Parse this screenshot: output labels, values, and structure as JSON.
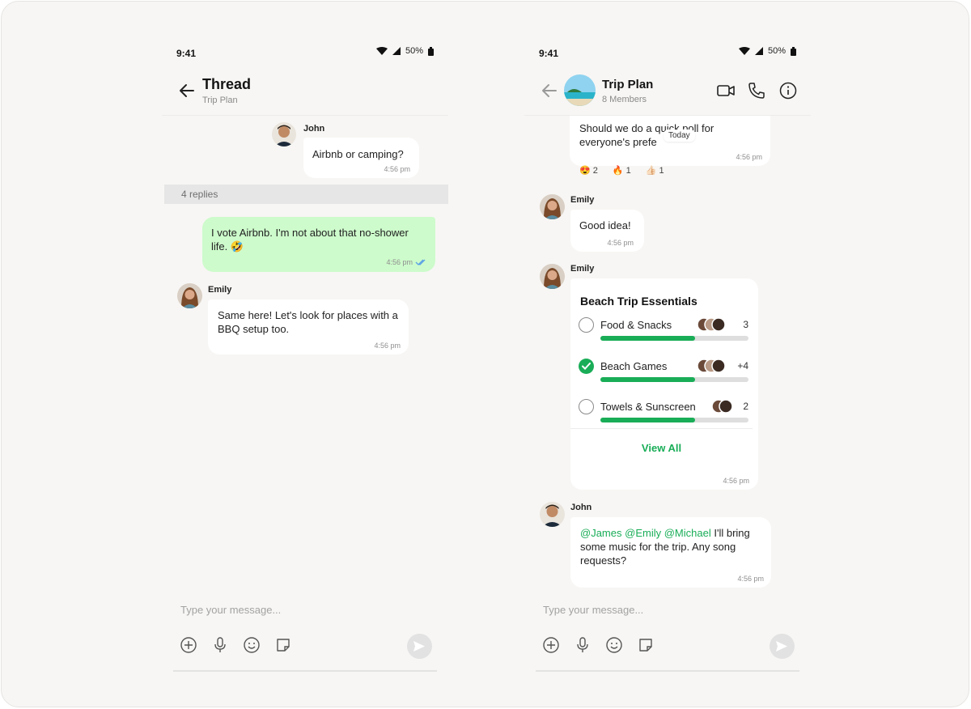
{
  "status": {
    "time": "9:41",
    "battery": "50%"
  },
  "thread": {
    "title": "Thread",
    "subtitle": "Trip Plan",
    "root": {
      "sender": "John",
      "text": "Airbnb or camping?",
      "time": "4:56 pm"
    },
    "replies_label": "4 replies",
    "mine": {
      "text": "I vote Airbnb. I'm not about that no-shower life. 🤣",
      "time": "4:56 pm"
    },
    "emily": {
      "sender": "Emily",
      "text": "Same here! Let's look for places with a BBQ setup too.",
      "time": "4:56 pm"
    },
    "composer_placeholder": "Type your message..."
  },
  "chat": {
    "title": "Trip Plan",
    "subtitle": "8 Members",
    "first": {
      "text_line1": "Should we do a quick poll for",
      "text_line2": "everyone's prefe",
      "time": "4:56 pm"
    },
    "date_pill": "Today",
    "reactions": [
      {
        "emoji": "😍",
        "count": "2"
      },
      {
        "emoji": "🔥",
        "count": "1"
      },
      {
        "emoji": "👍🏻",
        "count": "1"
      }
    ],
    "emily_msg": {
      "sender": "Emily",
      "text": "Good idea!",
      "time": "4:56 pm"
    },
    "poll": {
      "sender": "Emily",
      "title": "Beach Trip Essentials",
      "options": [
        {
          "label": "Food & Snacks",
          "count": "3",
          "checked": false,
          "fill": 0.64
        },
        {
          "label": "Beach Games",
          "count": "+4",
          "checked": true,
          "fill": 0.64
        },
        {
          "label": "Towels & Sunscreen",
          "count": "2",
          "checked": false,
          "fill": 0.64
        }
      ],
      "view_all": "View All",
      "time": "4:56 pm"
    },
    "john_msg": {
      "sender": "John",
      "mention1": "@James",
      "mention2": "@Emily",
      "mention3": "@Michael",
      "after_mentions": "I'll bring",
      "rest": "some music for the trip. Any song requests?",
      "time": "4:56 pm"
    },
    "composer_placeholder": "Type your message..."
  },
  "colors": {
    "accent": "#19ad57",
    "my_bubble": "#cdfbcb",
    "background": "#f7f6f4"
  }
}
